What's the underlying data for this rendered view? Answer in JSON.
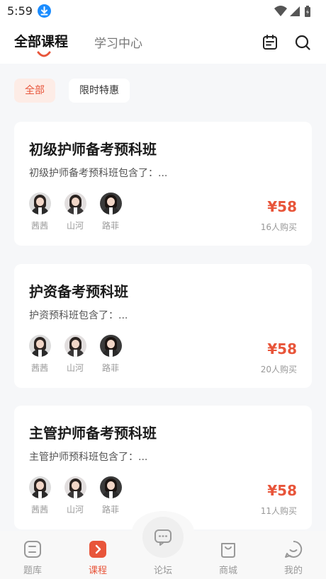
{
  "status_bar": {
    "time": "5:59"
  },
  "header": {
    "tabs": [
      {
        "label": "全部课程",
        "active": true
      },
      {
        "label": "学习中心",
        "active": false
      }
    ],
    "accent_color": "#e8553a"
  },
  "filters": [
    {
      "label": "全部",
      "selected": true
    },
    {
      "label": "限时特惠",
      "selected": false
    }
  ],
  "courses": [
    {
      "title": "初级护师备考预科班",
      "desc": "初级护师备考预科班包含了：...",
      "teachers": [
        "茜茜",
        "山河",
        "路菲"
      ],
      "price": "¥58",
      "buyers": "16人购买"
    },
    {
      "title": "护资备考预科班",
      "desc": "护资预科班包含了：...",
      "teachers": [
        "茜茜",
        "山河",
        "路菲"
      ],
      "price": "¥58",
      "buyers": "20人购买"
    },
    {
      "title": "主管护师备考预科班",
      "desc": "主管护师预科班包含了：...",
      "teachers": [
        "茜茜",
        "山河",
        "路菲"
      ],
      "price": "¥58",
      "buyers": "11人购买"
    }
  ],
  "bottom_nav": [
    {
      "label": "题库",
      "icon": "question-bank-icon",
      "active": false
    },
    {
      "label": "课程",
      "icon": "course-play-icon",
      "active": true
    },
    {
      "label": "论坛",
      "icon": "forum-chat-icon",
      "active": false
    },
    {
      "label": "商城",
      "icon": "mall-bag-icon",
      "active": false
    },
    {
      "label": "我的",
      "icon": "profile-smile-icon",
      "active": false
    }
  ]
}
